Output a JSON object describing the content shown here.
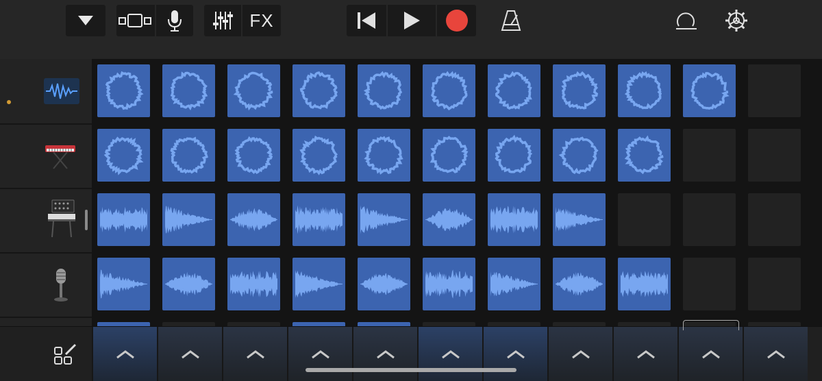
{
  "toolbar": {
    "fx_label": "FX",
    "icons": [
      "browser-dropdown-icon",
      "view-toggle-icon",
      "microphone-icon",
      "mixer-icon",
      "rewind-icon",
      "play-icon",
      "record-icon",
      "metronome-icon",
      "loop-icon",
      "settings-icon"
    ]
  },
  "colors": {
    "cell_filled": "#3c64b0",
    "waveform": "#78a6f0",
    "cell_empty": "#222222",
    "record": "#e8453c",
    "track_dot": "#d39b34"
  },
  "tracks": [
    {
      "name": "audio-track",
      "icon": "waveform-track-icon",
      "selected": true,
      "filled": 10,
      "wave": "ring"
    },
    {
      "name": "keyboard-track",
      "icon": "keyboard-icon",
      "selected": false,
      "filled": 9,
      "wave": "ring"
    },
    {
      "name": "synth-track",
      "icon": "synth-icon",
      "selected": false,
      "filled": 8,
      "wave": "line"
    },
    {
      "name": "vocal-track",
      "icon": "microphone-stand-icon",
      "selected": false,
      "filled": 9,
      "wave": "line"
    }
  ],
  "columns": 11,
  "triggers": 11,
  "lit_triggers": [
    0,
    5,
    6
  ]
}
